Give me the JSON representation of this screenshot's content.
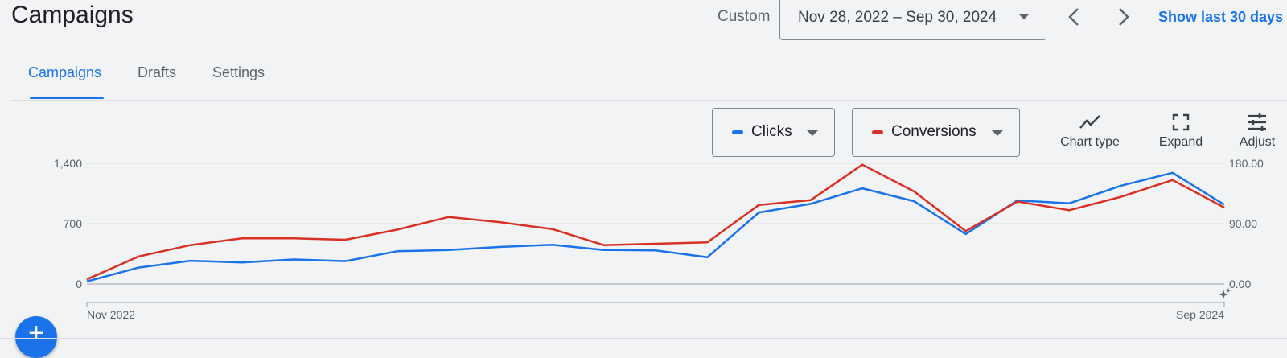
{
  "header": {
    "title": "Campaigns",
    "date_range_label": "Custom",
    "date_range_value": "Nov 28, 2022 – Sep 30, 2024",
    "prev_icon": "chevron-left-icon",
    "next_icon": "chevron-right-icon",
    "show_last_label": "Show last 30 days"
  },
  "tabs": [
    {
      "label": "Campaigns",
      "active": true
    },
    {
      "label": "Drafts",
      "active": false
    },
    {
      "label": "Settings",
      "active": false
    }
  ],
  "metric_selectors": [
    {
      "label": "Clicks",
      "color": "#1a73e8"
    },
    {
      "label": "Conversions",
      "color": "#d93025"
    }
  ],
  "tools": [
    {
      "label": "Chart type",
      "icon": "line-chart-icon"
    },
    {
      "label": "Expand",
      "icon": "expand-icon"
    },
    {
      "label": "Adjust",
      "icon": "tune-icon"
    }
  ],
  "chart_data": {
    "type": "line",
    "x_start_label": "Nov 2022",
    "x_end_label": "Sep 2024",
    "y_left_ticks": [
      "1,400",
      "700",
      "0"
    ],
    "y_right_ticks": [
      "180.00",
      "90.00",
      "0.00"
    ],
    "ylim_left": [
      0,
      1400
    ],
    "ylim_right": [
      0,
      180
    ],
    "grid": true,
    "series": [
      {
        "name": "Clicks",
        "axis": "left",
        "color": "#1a73e8",
        "values": [
          30,
          190,
          270,
          250,
          285,
          265,
          380,
          395,
          430,
          455,
          395,
          390,
          310,
          830,
          930,
          1110,
          960,
          580,
          970,
          935,
          1140,
          1290,
          920
        ]
      },
      {
        "name": "Conversions",
        "axis": "right",
        "color": "#d93025",
        "values": [
          7,
          41,
          58,
          68,
          68,
          66,
          81,
          100,
          92,
          82,
          58,
          60,
          62,
          118,
          125,
          178,
          138,
          79,
          123,
          110,
          130,
          155,
          114
        ]
      }
    ]
  },
  "fab": {
    "label": "+",
    "icon": "add-icon"
  }
}
